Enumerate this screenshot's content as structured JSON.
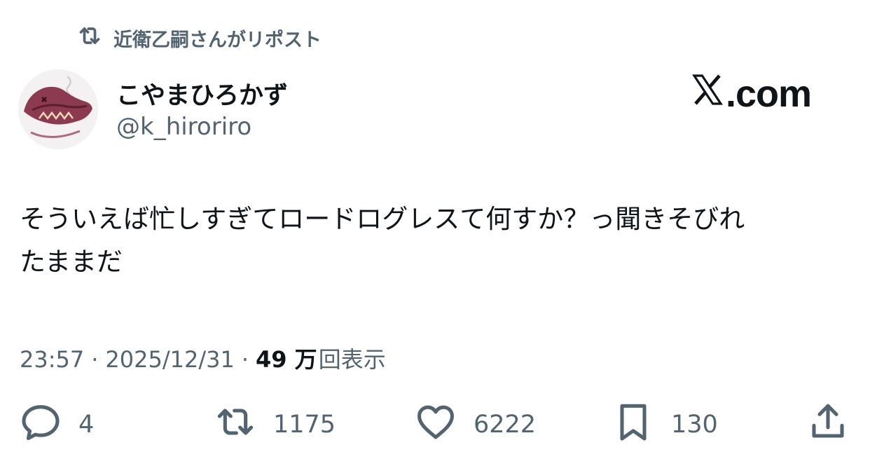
{
  "repost": {
    "label": "近衛乙嗣さんがリポスト",
    "icon": "repost-icon"
  },
  "author": {
    "display_name": "こやまひろかず",
    "handle": "@k_hiroriro",
    "avatar_icon": "avatar-dragon"
  },
  "brand": {
    "label": ".com",
    "icon": "x-logo-icon"
  },
  "tweet": {
    "text_line1": "そういえば忙しすぎてロードログレスて何すか？っ聞きそびれ",
    "text_line2": "たままだ"
  },
  "meta": {
    "time": "23:57",
    "separator": "·",
    "date": "2025/12/31",
    "views_count": "49 万",
    "views_label": "回表示"
  },
  "actions": {
    "reply_count": "4",
    "repost_count": "1175",
    "like_count": "6222",
    "bookmark_count": "130"
  },
  "colors": {
    "primary_text": "#0f1419",
    "secondary_text": "#536471",
    "background": "#ffffff"
  }
}
